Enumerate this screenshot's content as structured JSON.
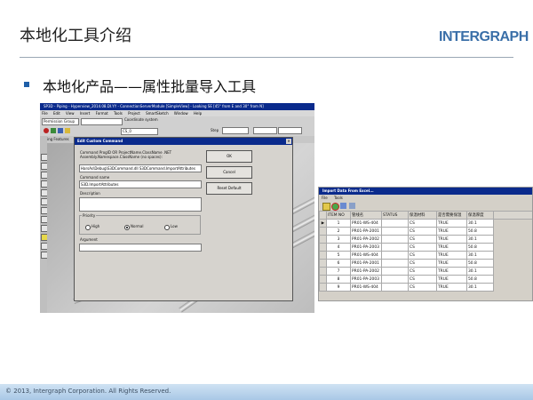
{
  "slide": {
    "title": "本地化工具介绍",
    "logo": "INTERGRAPH",
    "bullet": "本地化产品——属性批量导入工具",
    "footer": "© 2013, Intergraph Corporation. All Rights Reserved."
  },
  "app": {
    "title": "SP3D - Piping - Hyperview_2014.08.DI.YY - ConnectionServerModule [SimpleView] - Looking SE [45° from E and 30° from N]",
    "menu": [
      "File",
      "Edit",
      "View",
      "Insert",
      "Format",
      "Tools",
      "Project",
      "SmartSketch",
      "Window",
      "Help"
    ],
    "toolbar": {
      "permission_group": "Permission Group",
      "coordinate_system_label": "Coordinate system",
      "coordinate_value": "CS_0",
      "step_label": "Step",
      "panel_label": "Piping Features"
    }
  },
  "dialog": {
    "title": "Edit Custom Command",
    "instructions": "Command ProgID OR ProjectName.ClassName .NET Assembly.Namespace.ClassName (no spaces):",
    "progid_value": "HarsAs\\Debug\\S3DCommand.dll S3DCommand.ImportAttributes",
    "command_name_label": "Command name",
    "command_name_value": "S3D.ImportAttributes",
    "description_label": "Description",
    "description_value": "",
    "priority_label": "Priority",
    "priority_options": [
      "High",
      "Normal",
      "Low"
    ],
    "priority_selected": "Normal",
    "argument_label": "Argument",
    "argument_value": "",
    "buttons": {
      "ok": "OK",
      "cancel": "Cancel",
      "reset": "Reset Default"
    }
  },
  "importer": {
    "title": "Import Data From Excel...",
    "menu": [
      "File",
      "Tools"
    ],
    "columns": [
      "ITEM NO",
      "管线名",
      "STATUS",
      "保温材料",
      "是否需要保温",
      "保温厚度"
    ],
    "rows": [
      [
        "1",
        "PR01-WS-404",
        "",
        "CS",
        "TRUE",
        "30.1"
      ],
      [
        "2",
        "PR01-PA-2001",
        "",
        "CS",
        "TRUE",
        "50.8"
      ],
      [
        "3",
        "PR01-PA-2002",
        "",
        "CS",
        "TRUE",
        "30.1"
      ],
      [
        "4",
        "PR01-PA-2003",
        "",
        "CS",
        "TRUE",
        "50.8"
      ],
      [
        "5",
        "PR01-WS-404",
        "",
        "CS",
        "TRUE",
        "30.1"
      ],
      [
        "6",
        "PR01-PA-2001",
        "",
        "CS",
        "TRUE",
        "50.8"
      ],
      [
        "7",
        "PR01-PA-2002",
        "",
        "CS",
        "TRUE",
        "30.1"
      ],
      [
        "8",
        "PR01-PA-2003",
        "",
        "CS",
        "TRUE",
        "50.8"
      ],
      [
        "9",
        "PR01-WS-404",
        "",
        "CS",
        "TRUE",
        "30.1"
      ]
    ]
  },
  "colors": {
    "brand_blue": "#1f5fa8",
    "titlebar_blue": "#0a2a8c",
    "footer_band": "#a9c8e6"
  }
}
